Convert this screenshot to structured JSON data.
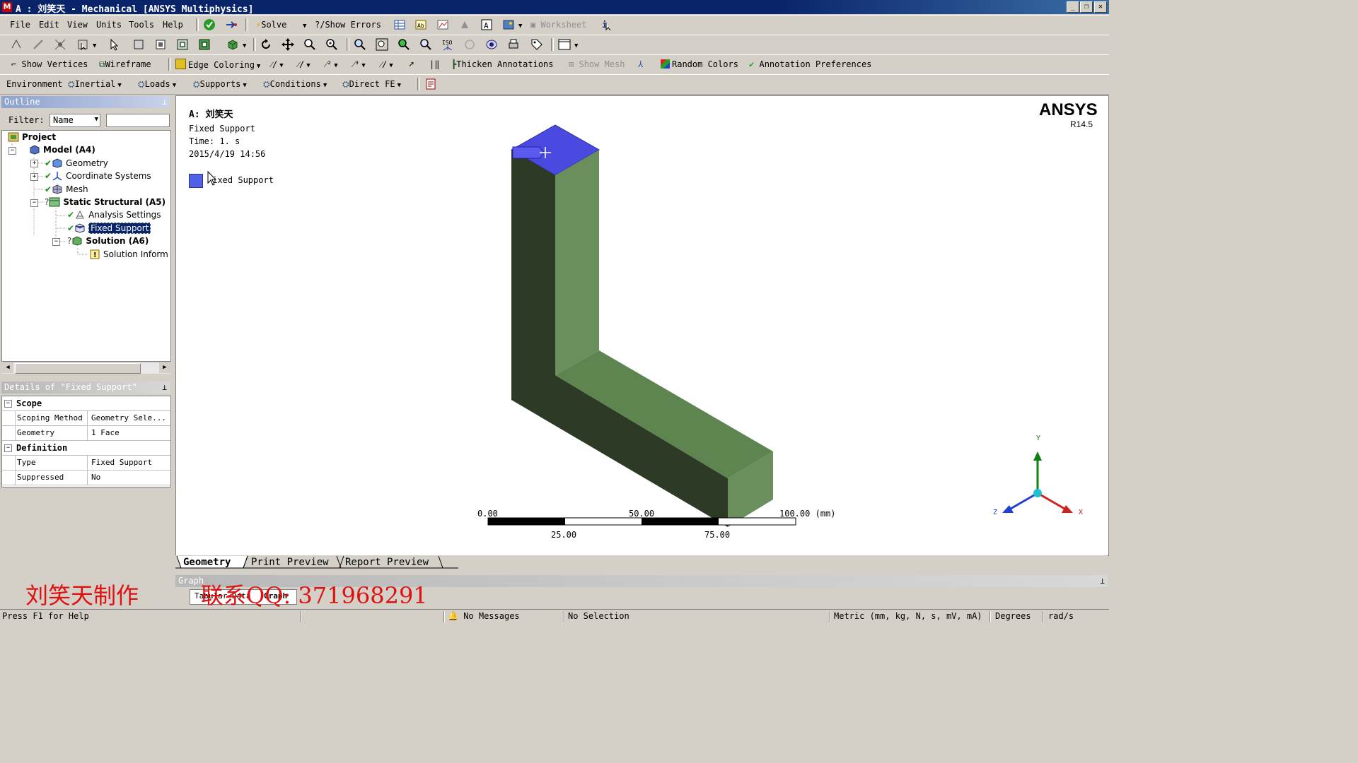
{
  "window": {
    "title": "A : 刘笑天 - Mechanical [ANSYS Multiphysics]",
    "app_icon": "M",
    "controls": [
      "minimize-icon",
      "restore-icon",
      "close-icon"
    ]
  },
  "menu": {
    "items": [
      "File",
      "Edit",
      "View",
      "Units",
      "Tools",
      "Help"
    ],
    "solve_label": "Solve",
    "show_errors_label": "?/Show Errors",
    "worksheet_label": "Worksheet"
  },
  "toolbar3": {
    "show_vertices": "Show Vertices",
    "wireframe": "Wireframe",
    "edge_coloring": "Edge Coloring",
    "thicken_annotations": "Thicken Annotations",
    "show_mesh": "Show Mesh",
    "random_colors": "Random Colors",
    "annotation_preferences": "Annotation Preferences"
  },
  "toolbar4": {
    "environment": "Environment",
    "inertial": "Inertial",
    "loads": "Loads",
    "supports": "Supports",
    "conditions": "Conditions",
    "direct_fe": "Direct FE"
  },
  "outline": {
    "title": "Outline",
    "filter_label": "Filter:",
    "filter_value": "Name",
    "tree": {
      "project": "Project",
      "model": "Model (A4)",
      "geometry": "Geometry",
      "coordinate_systems": "Coordinate Systems",
      "mesh": "Mesh",
      "static_structural": "Static Structural (A5)",
      "analysis_settings": "Analysis Settings",
      "fixed_support": "Fixed Support",
      "solution": "Solution (A6)",
      "solution_information": "Solution Inform"
    }
  },
  "details": {
    "title": "Details of \"Fixed Support\"",
    "sections": {
      "scope": "Scope",
      "definition": "Definition"
    },
    "rows": {
      "scoping_method_key": "Scoping Method",
      "scoping_method_val": "Geometry Sele...",
      "geometry_key": "Geometry",
      "geometry_val": "1 Face",
      "type_key": "Type",
      "type_val": "Fixed Support",
      "suppressed_key": "Suppressed",
      "suppressed_val": "No"
    }
  },
  "viewport": {
    "annotation": {
      "title": "A: 刘笑天",
      "object": "Fixed Support",
      "time": "Time: 1. s",
      "date": "2015/4/19 14:56",
      "legend_label": "Fixed Support"
    },
    "brand": "ANSYS",
    "version": "R14.5",
    "scale": {
      "top_labels": [
        "0.00",
        "50.00",
        "100.00 (mm)"
      ],
      "bottom_labels": [
        "25.00",
        "75.00"
      ]
    },
    "triad": {
      "x": "X",
      "y": "Y",
      "z": "Z"
    },
    "colors": {
      "support_face": "#4a4ae0",
      "body_front": "#2c3a26",
      "body_side": "#6a8e5c",
      "body_top": "#5e8450"
    }
  },
  "tabs": [
    "Geometry",
    "Print Preview",
    "Report Preview"
  ],
  "graph": {
    "title": "Graph",
    "subtab": "Tabular Data",
    "subtab2": "Graph"
  },
  "watermark": {
    "left": "刘笑天制作",
    "right": "联系QQ: 371968291"
  },
  "status": {
    "help": "Press F1 for Help",
    "messages": "No Messages",
    "selection": "No Selection",
    "units": "Metric (mm, kg, N, s, mV, mA)",
    "angle": "Degrees",
    "rate": "rad/s"
  }
}
